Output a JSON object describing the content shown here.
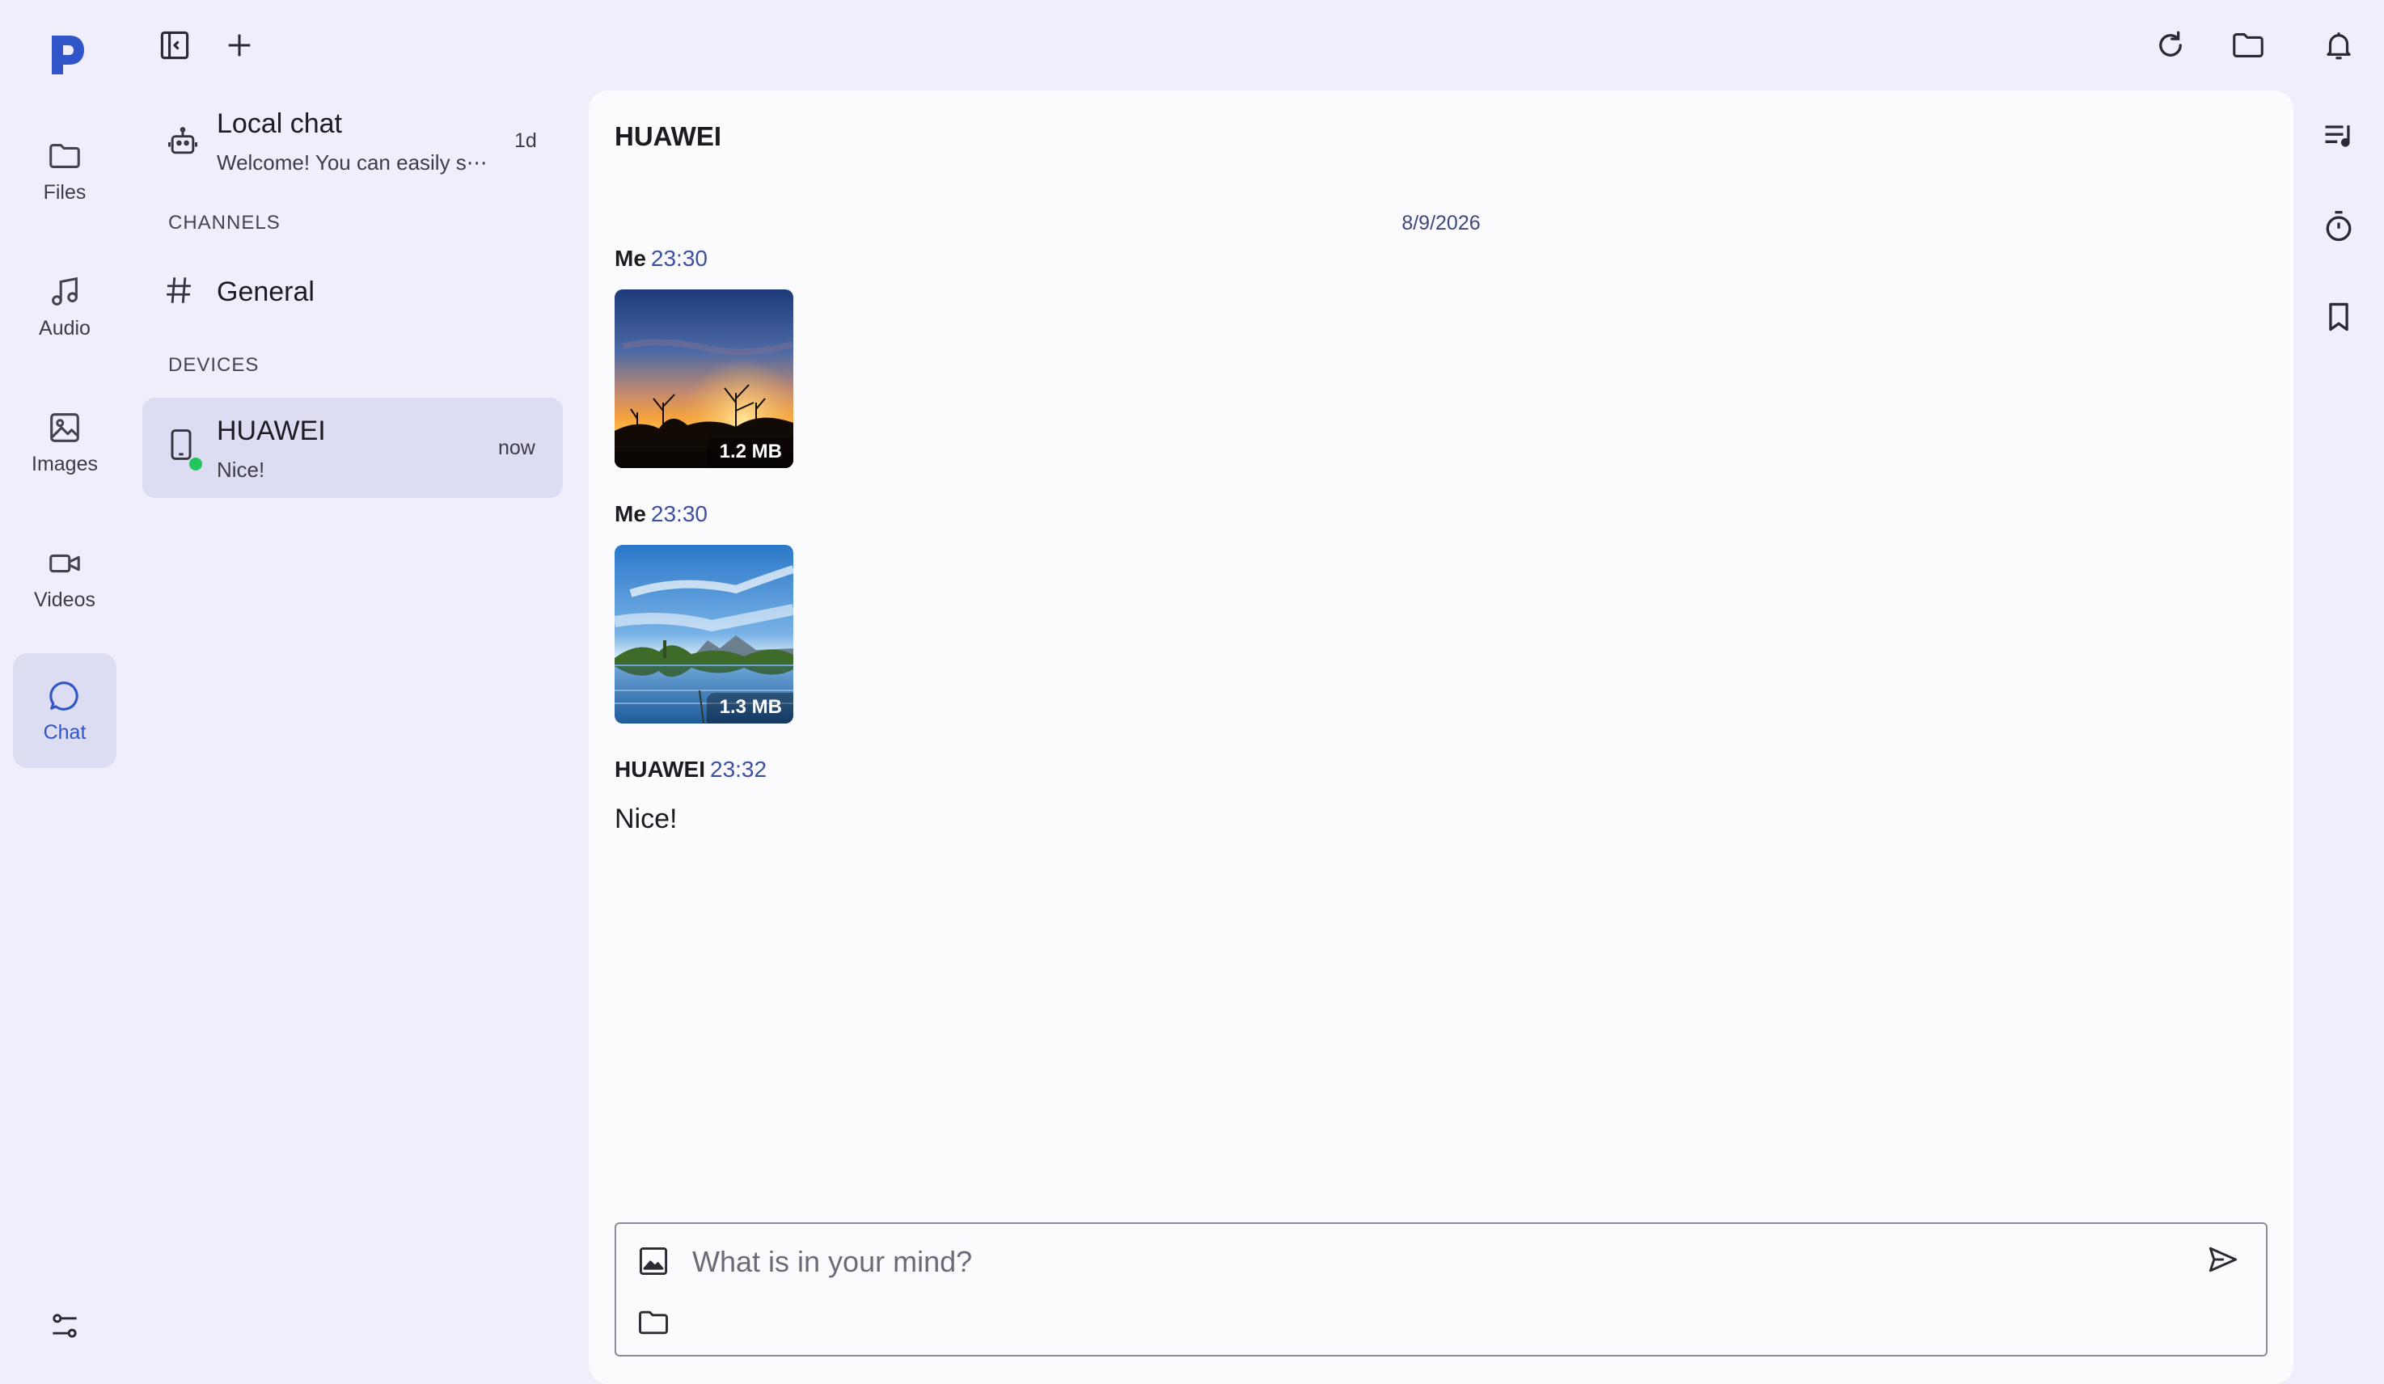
{
  "app": {
    "brand_color": "#2f55c8",
    "accent_bg": "#dcdcf2",
    "online_color": "#22c55e"
  },
  "nav": {
    "items": [
      {
        "label": "Files",
        "icon": "folder-icon"
      },
      {
        "label": "Audio",
        "icon": "music-note-icon"
      },
      {
        "label": "Images",
        "icon": "image-icon"
      },
      {
        "label": "Videos",
        "icon": "video-camera-icon"
      },
      {
        "label": "Chat",
        "icon": "chat-bubble-icon",
        "active": true
      }
    ]
  },
  "chat_list": {
    "local_chat": {
      "title": "Local chat",
      "preview": "Welcome! You can easily s⋯",
      "time": "1d"
    },
    "channels_header": "CHANNELS",
    "channels": [
      {
        "name": "General"
      }
    ],
    "devices_header": "DEVICES",
    "devices": [
      {
        "name": "HUAWEI",
        "preview": "Nice!",
        "time": "now",
        "online": true,
        "selected": true
      }
    ]
  },
  "conversation": {
    "title": "HUAWEI",
    "date": "8/9/2026",
    "messages": [
      {
        "sender": "Me",
        "time": "23:30",
        "type": "image",
        "size": "1.2 MB",
        "scene": "sunset"
      },
      {
        "sender": "Me",
        "time": "23:30",
        "type": "image",
        "size": "1.3 MB",
        "scene": "lake"
      },
      {
        "sender": "HUAWEI",
        "time": "23:32",
        "type": "text",
        "text": "Nice!"
      }
    ]
  },
  "composer": {
    "placeholder": "What is in your mind?"
  }
}
